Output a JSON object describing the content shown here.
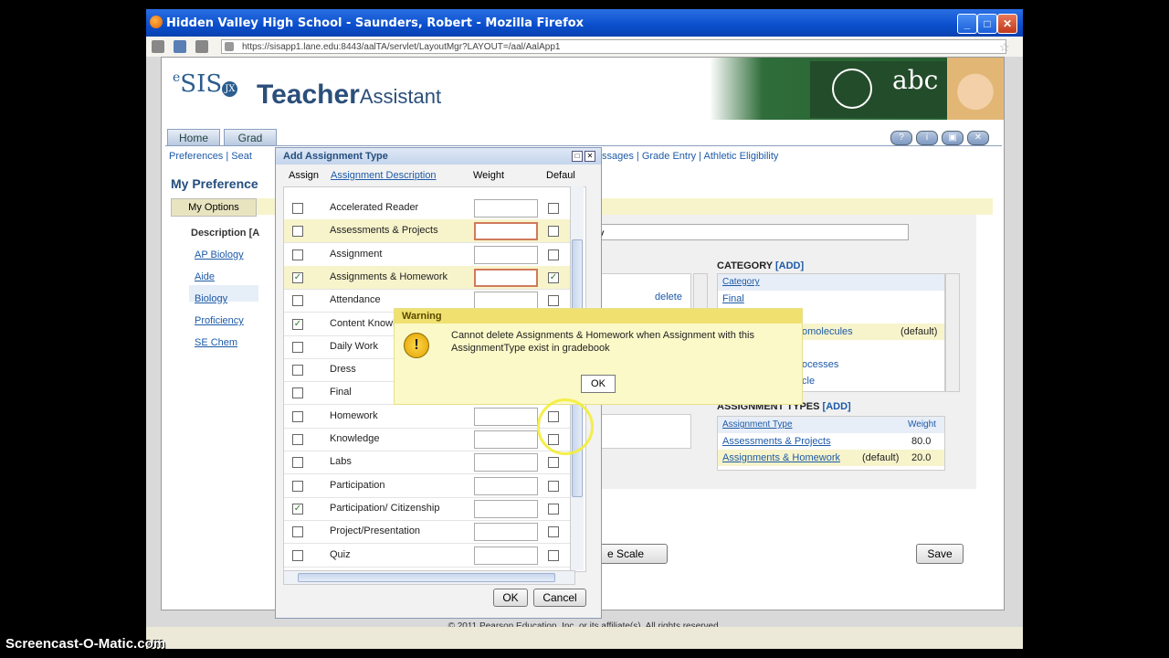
{
  "browser": {
    "title": "Hidden Valley High School - Saunders, Robert - Mozilla Firefox",
    "url": "https://sisapp1.lane.edu:8443/aalTA/servlet/LayoutMgr?LAYOUT=/aal/AalApp1",
    "buttons": {
      "minimize": "_",
      "maximize": "□",
      "close": "✕"
    }
  },
  "app": {
    "logo": "SIS",
    "logo_e": "e",
    "logo_jx": "JX",
    "title_main": "Teacher",
    "title_sub": "Assistant",
    "chalkboard_text": "abc"
  },
  "tabs": [
    {
      "label": "Home"
    },
    {
      "label": "Grad"
    }
  ],
  "subnav": {
    "left": "Preferences | Seat",
    "right": "ssages | Grade Entry | Athletic Eligibility"
  },
  "page": {
    "section_title": "My Preference",
    "my_options_tab": "My Options",
    "description_label": "Description [A",
    "descriptions": [
      "AP Biology",
      "Aide",
      "Biology",
      "Proficiency",
      "SE Chem"
    ],
    "course_field_value": "ogy",
    "delete_link": "delete",
    "category": {
      "heading": "CATEGORY",
      "add": "[ADD]",
      "column": "Category",
      "rows": [
        "Final",
        "",
        "omolecules",
        "",
        "ocesses",
        "cle"
      ],
      "default_label": "(default)"
    },
    "assignment_types": {
      "heading": "ASSIGNMENT TYPES",
      "add": "[ADD]",
      "col_type": "Assignment Type",
      "col_weight": "Weight",
      "rows": [
        {
          "name": "Assessments & Projects",
          "default": "",
          "weight": "80.0"
        },
        {
          "name": "Assignments & Homework",
          "default": "(default)",
          "weight": "20.0"
        }
      ]
    },
    "grade_scale_button": "e Scale",
    "save_button": "Save"
  },
  "dialog": {
    "title": "Add Assignment Type",
    "columns": {
      "assign": "Assign",
      "description": "Assignment Description",
      "weight": "Weight",
      "default": "Defaul"
    },
    "rows": [
      {
        "label": "Accelerated Reader",
        "assign": false,
        "default": false,
        "highlight": false,
        "error": false
      },
      {
        "label": "Assessments & Projects",
        "assign": false,
        "default": false,
        "highlight": true,
        "error": true
      },
      {
        "label": "Assignment",
        "assign": false,
        "default": false,
        "highlight": false,
        "error": false
      },
      {
        "label": "Assignments & Homework",
        "assign": true,
        "default": true,
        "highlight": true,
        "error": true
      },
      {
        "label": "Attendance",
        "assign": false,
        "default": false,
        "highlight": false,
        "error": false
      },
      {
        "label": "Content Knowlege and Skills",
        "assign": true,
        "default": false,
        "highlight": false,
        "error": false
      },
      {
        "label": "Daily Work",
        "assign": false,
        "default": false,
        "highlight": false,
        "error": false
      },
      {
        "label": "Dress",
        "assign": false,
        "default": false,
        "highlight": false,
        "error": false
      },
      {
        "label": "Final",
        "assign": false,
        "default": false,
        "highlight": false,
        "error": false
      },
      {
        "label": "Homework",
        "assign": false,
        "default": false,
        "highlight": false,
        "error": false
      },
      {
        "label": "Knowledge",
        "assign": false,
        "default": false,
        "highlight": false,
        "error": false
      },
      {
        "label": "Labs",
        "assign": false,
        "default": false,
        "highlight": false,
        "error": false
      },
      {
        "label": "Participation",
        "assign": false,
        "default": false,
        "highlight": false,
        "error": false
      },
      {
        "label": "Participation/ Citizenship",
        "assign": true,
        "default": false,
        "highlight": false,
        "error": false
      },
      {
        "label": "Project/Presentation",
        "assign": false,
        "default": false,
        "highlight": false,
        "error": false
      },
      {
        "label": "Quiz",
        "assign": false,
        "default": false,
        "highlight": false,
        "error": false
      }
    ],
    "ok_button": "OK",
    "cancel_button": "Cancel"
  },
  "warning": {
    "title": "Warning",
    "message": "Cannot delete Assignments & Homework when Assignment with this AssignmentType exist in gradebook",
    "ok_button": "OK"
  },
  "footer": "© 2011 Pearson Education, Inc. or its affiliate(s). All rights reserved.",
  "watermark": "Screencast-O-Matic.com",
  "colors": {
    "highlight_row": "#f7f4cc",
    "link": "#1d5aa8",
    "error_border": "#d07a5a",
    "warning_bg": "#fbf9c8"
  }
}
